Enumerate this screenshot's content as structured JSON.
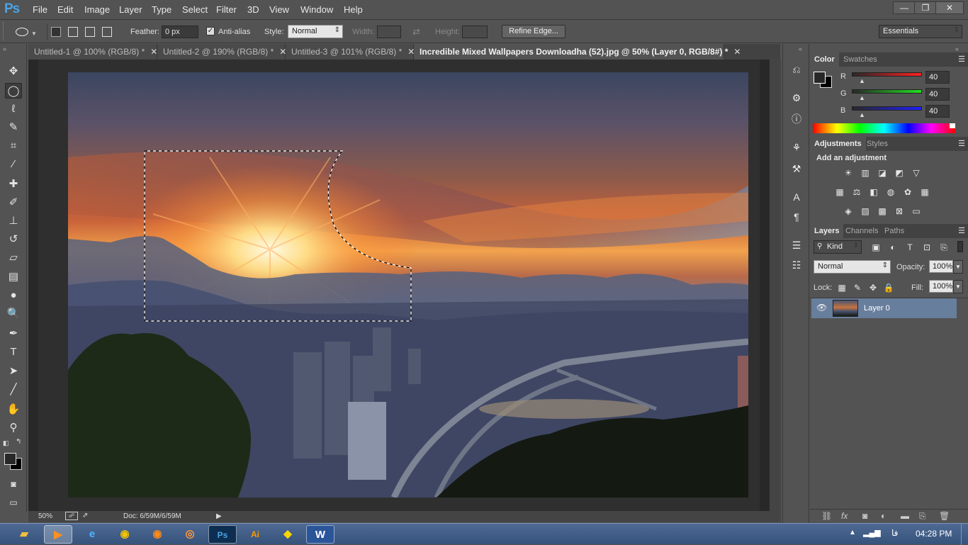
{
  "app": {
    "logo": "Ps"
  },
  "menu": [
    "File",
    "Edit",
    "Image",
    "Layer",
    "Type",
    "Select",
    "Filter",
    "3D",
    "View",
    "Window",
    "Help"
  ],
  "window_controls": {
    "minimize": "—",
    "restore": "❐",
    "close": "✕"
  },
  "options": {
    "feather_label": "Feather:",
    "feather_value": "0 px",
    "antialias_label": "Anti-alias",
    "style_label": "Style:",
    "style_value": "Normal",
    "width_label": "Width:",
    "height_label": "Height:",
    "refine_edge": "Refine Edge...",
    "workspace": "Essentials"
  },
  "tabs": [
    {
      "label": "Untitled-1 @ 100% (RGB/8) *",
      "close": "✕"
    },
    {
      "label": "Untitled-2 @ 190% (RGB/8) *",
      "close": "✕"
    },
    {
      "label": "Untitled-3 @ 101% (RGB/8) *",
      "close": "✕"
    },
    {
      "label": "Incredible Mixed Wallpapers Downloadha (52).jpg @ 50% (Layer 0, RGB/8#) *",
      "close": "✕"
    }
  ],
  "status": {
    "zoom": "50%",
    "doc": "Doc: 6/59M/6/59M"
  },
  "color_panel": {
    "tabs": [
      "Color",
      "Swatches"
    ],
    "channels": [
      {
        "label": "R",
        "value": "40"
      },
      {
        "label": "G",
        "value": "40"
      },
      {
        "label": "B",
        "value": "40"
      }
    ]
  },
  "adjustments_panel": {
    "tabs": [
      "Adjustments",
      "Styles"
    ],
    "heading": "Add an adjustment"
  },
  "layers_panel": {
    "tabs": [
      "Layers",
      "Channels",
      "Paths"
    ],
    "filter_kind": "Kind",
    "blend_mode": "Normal",
    "opacity_label": "Opacity:",
    "opacity_value": "100%",
    "lock_label": "Lock:",
    "fill_label": "Fill:",
    "fill_value": "100%",
    "layers": [
      {
        "name": "Layer 0",
        "visible": true
      }
    ]
  },
  "taskbar": {
    "clock": "04:28 PM",
    "lang": "فا",
    "apps": [
      "file-explorer",
      "media-player",
      "internet-explorer",
      "chrome",
      "firefox",
      "blender",
      "photoshop",
      "illustrator",
      "norton",
      "word"
    ],
    "ps_label": "Ps",
    "ai_label": "Ai",
    "word_label": "W"
  },
  "colors": {
    "ui_bg": "#535353",
    "tab_active": "#535353",
    "layer_selected": "#687e9d",
    "taskbar": "#3b5680",
    "ps_blue": "#4ba3e3"
  }
}
